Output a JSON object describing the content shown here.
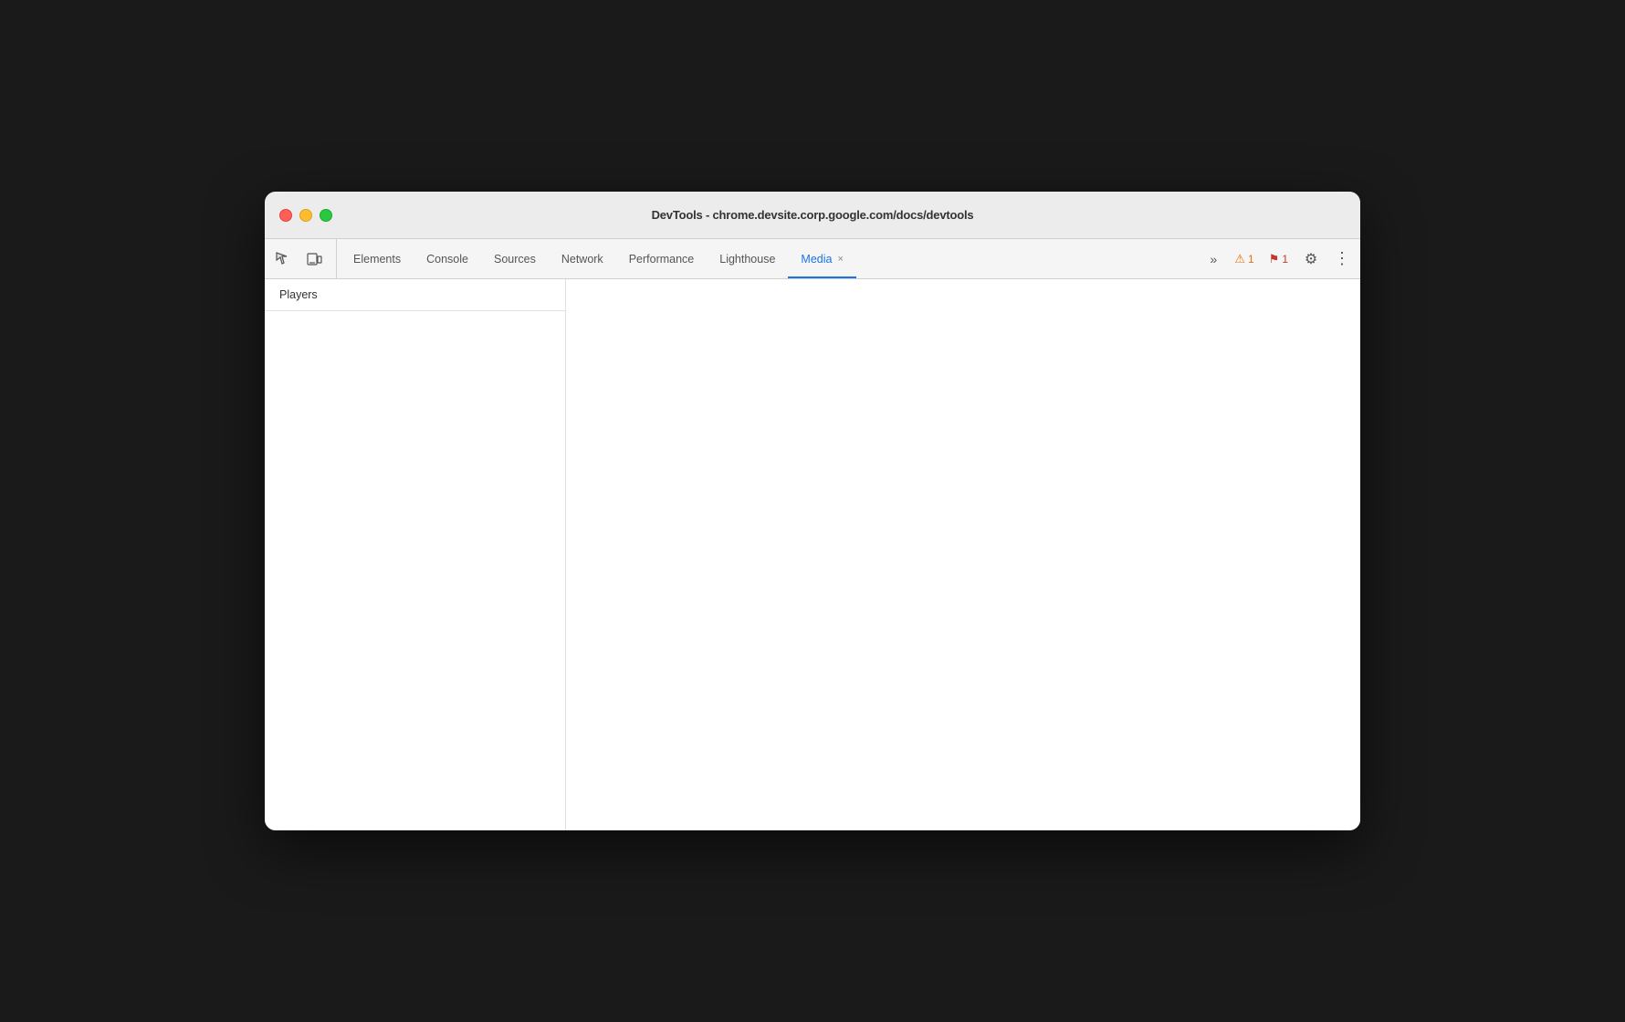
{
  "window": {
    "title": "DevTools - chrome.devsite.corp.google.com/docs/devtools"
  },
  "traffic_lights": {
    "close_label": "close",
    "minimize_label": "minimize",
    "maximize_label": "maximize"
  },
  "toolbar": {
    "inspect_icon": "⬚",
    "device_icon": "⧉",
    "more_tabs_icon": "»"
  },
  "tabs": [
    {
      "id": "elements",
      "label": "Elements",
      "active": false,
      "closable": false
    },
    {
      "id": "console",
      "label": "Console",
      "active": false,
      "closable": false
    },
    {
      "id": "sources",
      "label": "Sources",
      "active": false,
      "closable": false
    },
    {
      "id": "network",
      "label": "Network",
      "active": false,
      "closable": false
    },
    {
      "id": "performance",
      "label": "Performance",
      "active": false,
      "closable": false
    },
    {
      "id": "lighthouse",
      "label": "Lighthouse",
      "active": false,
      "closable": false
    },
    {
      "id": "media",
      "label": "Media",
      "active": true,
      "closable": true
    }
  ],
  "badges": {
    "warning": {
      "icon": "⚠",
      "count": "1"
    },
    "error": {
      "icon": "⚑",
      "count": "1"
    }
  },
  "sidebar": {
    "header": "Players"
  },
  "icons": {
    "settings": "⚙",
    "more": "⋮",
    "close": "×"
  }
}
